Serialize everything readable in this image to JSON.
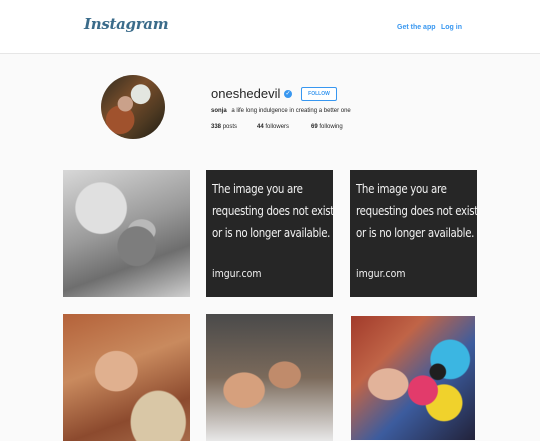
{
  "header": {
    "logo_text": "Instagram",
    "get_app_label": "Get the app",
    "login_label": "Log in",
    "accent_color": "#3897f0"
  },
  "profile": {
    "username": "oneshedevil",
    "verified_icon": "verified-badge-icon",
    "follow_label": "FOLLOW",
    "bio_name": "sonja",
    "bio_text": "a life long indulgence in creating a better one",
    "posts_count": "338",
    "posts_label": "posts",
    "followers_count": "44",
    "followers_label": "followers",
    "following_count": "69",
    "following_label": "following"
  },
  "posts": [
    {
      "kind": "photo",
      "subject": "black-and-white dog"
    },
    {
      "kind": "unavailable",
      "line1": "The image you are",
      "line2": "requesting does not exist",
      "line3": "or is no longer available.",
      "site": "imgur.com"
    },
    {
      "kind": "unavailable",
      "line1": "The image you are",
      "line2": "requesting does not exist",
      "line3": "or is no longer available.",
      "site": "imgur.com"
    },
    {
      "kind": "photo",
      "subject": "woman with dog"
    },
    {
      "kind": "photo",
      "subject": "couple in car"
    },
    {
      "kind": "photo",
      "subject": "woman with painted skull art"
    }
  ]
}
